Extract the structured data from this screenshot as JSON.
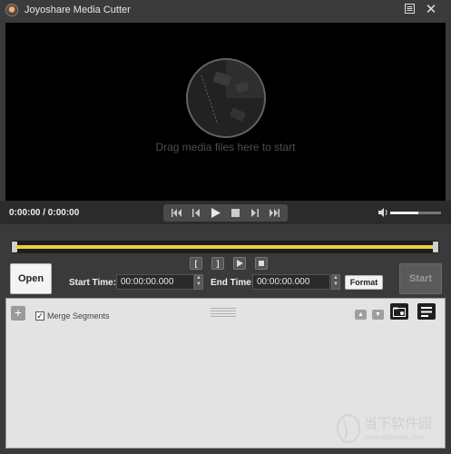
{
  "window": {
    "title": "Joyoshare Media Cutter"
  },
  "titlebar": {
    "menu_icon": "menu-icon",
    "close_icon": "close-icon",
    "close_glyph": "✕"
  },
  "player": {
    "drop_text": "Drag media files here to start",
    "time": "0:00:00 / 0:00:00",
    "volume_level": 0.55
  },
  "segment_controls": {
    "mark_in": "[",
    "mark_out": "]"
  },
  "trim": {
    "open_label": "Open",
    "start_time_label": "Start Time:",
    "start_time_value": "00:00:00.000",
    "end_time_label": "End Time:",
    "end_time_value": "00:00:00.000",
    "format_label": "Format",
    "start_label": "Start"
  },
  "list": {
    "add_glyph": "+",
    "merge_label": "Merge Segments",
    "merge_checked": true
  },
  "watermark": {
    "text": "当下软件园",
    "url": "www.downxia.com"
  },
  "colors": {
    "accent": "#e7d33c",
    "player_bg": "#000000",
    "panel_bg": "#e3e3e3"
  }
}
